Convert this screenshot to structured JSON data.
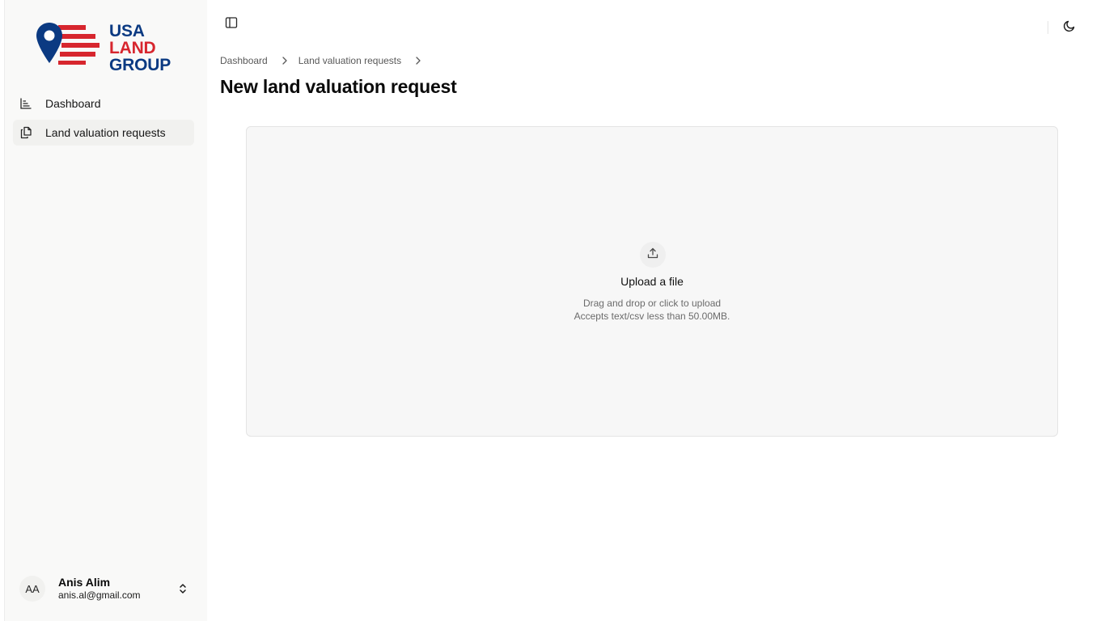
{
  "brand": {
    "line1": "USA",
    "line2": "LAND",
    "line3": "GROUP",
    "colors": {
      "blue": "#0b3a82",
      "red": "#d7262e"
    }
  },
  "sidebar": {
    "items": [
      {
        "label": "Dashboard",
        "icon": "bar-chart-icon",
        "active": false
      },
      {
        "label": "Land valuation requests",
        "icon": "files-icon",
        "active": true
      }
    ],
    "user": {
      "initials": "AA",
      "name": "Anis Alim",
      "email": "anis.al@gmail.com",
      "icon": "chevrons-up-down-icon"
    }
  },
  "header": {
    "toggle_icon": "panel-left-icon",
    "theme_icon": "moon-icon"
  },
  "breadcrumb": {
    "items": [
      "Dashboard",
      "Land valuation requests"
    ]
  },
  "page": {
    "title": "New land valuation request"
  },
  "upload": {
    "icon": "upload-icon",
    "title": "Upload a file",
    "hint_line1": "Drag and drop or click to upload",
    "hint_line2": "Accepts text/csv less than 50.00MB."
  }
}
